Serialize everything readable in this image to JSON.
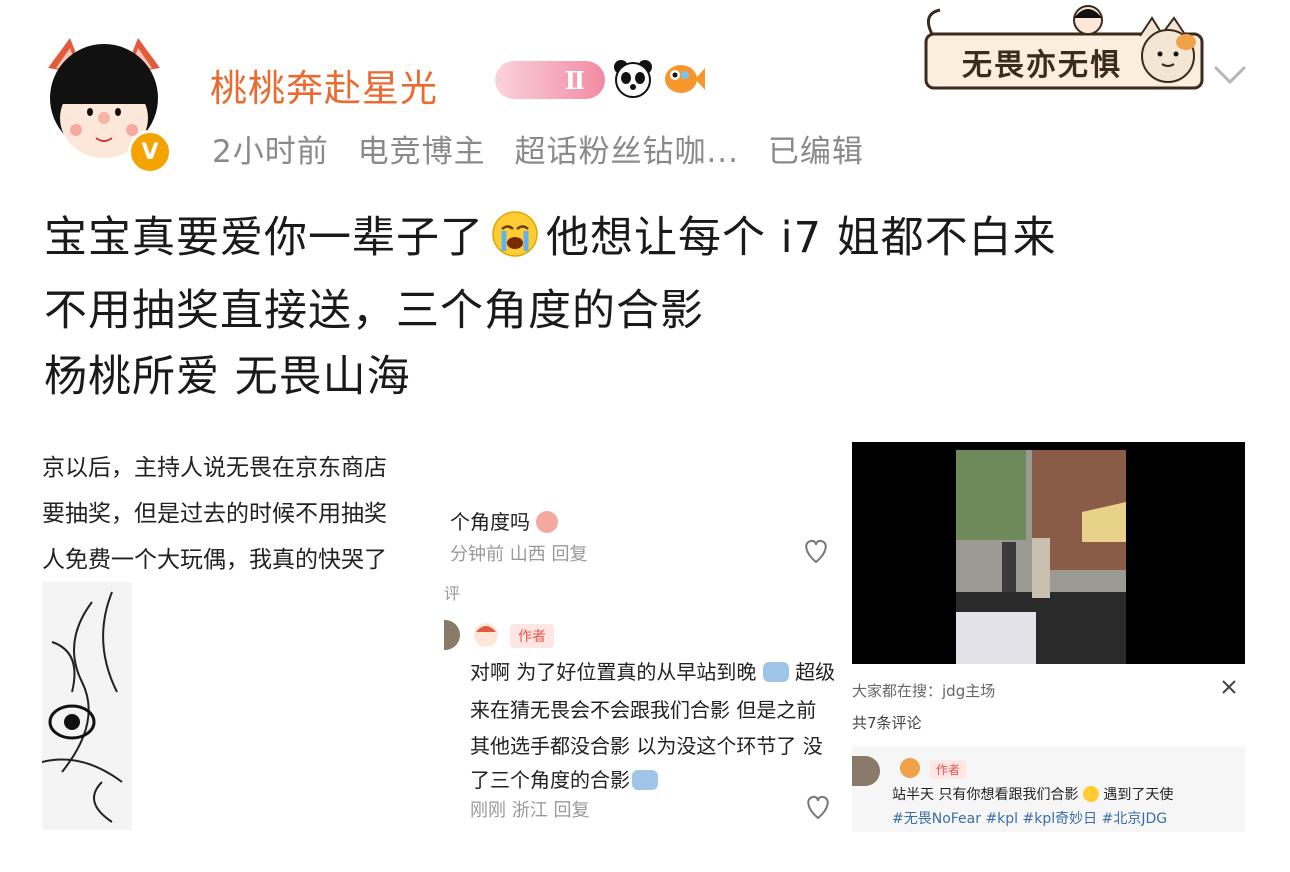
{
  "header": {
    "username": "桃桃奔赴星光",
    "level_badge": "Ⅱ",
    "time": "2小时前",
    "role": "电竞博主",
    "fan_info": "超话粉丝钻咖...",
    "edited": "已编辑",
    "banner_text": "无畏亦无惧",
    "verified_mark": "V"
  },
  "post": {
    "line1a": "宝宝真要爱你一辈子了",
    "line1b": "他想让每个 i7 姐都不白来",
    "line2": "不用抽奖直接送，三个角度的合影",
    "line3": "杨桃所爱 无畏山海"
  },
  "image1": {
    "line1": "京以后，主持人说无畏在京东商店",
    "line2": "要抽奖，但是过去的时候不用抽奖",
    "line3": "人免费一个大玩偶，我真的快哭了"
  },
  "image2": {
    "comment_tail": "个角度吗",
    "comment_meta": "分钟前 山西  回复",
    "section_label": "评",
    "author_tag": "作者",
    "reply_line1": "对啊 为了好位置真的从早站到晚",
    "reply_line1_tail": "超级",
    "reply_line2": "来在猜无畏会不会跟我们合影 但是之前",
    "reply_line3": "其他选手都没合影 以为没这个环节了 没",
    "reply_line4": "了三个角度的合影",
    "reply_meta": "刚刚 浙江  回复"
  },
  "image3": {
    "search_hint": "大家都在搜：jdg主场",
    "comment_count": "共7条评论",
    "author_tag": "作者",
    "reply_text": "站半天 只有你想看跟我们合影",
    "reply_tail": "遇到了天使",
    "hashtags": "#无畏NoFear #kpl #kpl奇妙日 #北京JDG"
  },
  "colors": {
    "username": "#ea6a2f",
    "meta": "#8a8a8a",
    "author_tag": "#e8564a",
    "hashtag": "#3a6ea8"
  }
}
